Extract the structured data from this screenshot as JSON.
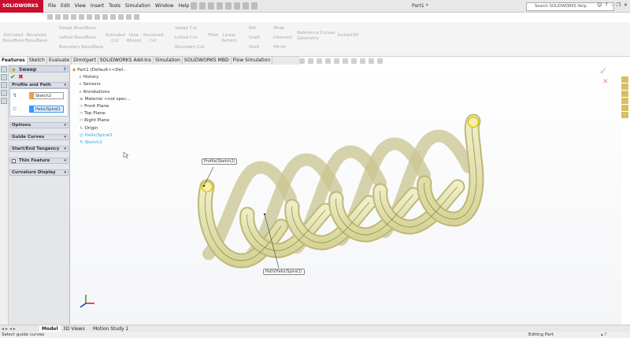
{
  "app": {
    "logo": "SOLIDWORKS",
    "doc_title": "Part1 *",
    "help_search_placeholder": "Search SOLIDWORKS Help"
  },
  "menu": [
    "File",
    "Edit",
    "View",
    "Insert",
    "Tools",
    "Simulation",
    "Window",
    "Help"
  ],
  "ribbon": {
    "extruded_boss": "Extruded Boss/Base",
    "revolved_boss": "Revolved Boss/Base",
    "swept_boss": "Swept Boss/Base",
    "lofted_boss": "Lofted Boss/Base",
    "boundary_boss": "Boundary Boss/Base",
    "extruded_cut": "Extruded Cut",
    "hole_wizard": "Hole Wizard",
    "revolved_cut": "Revolved Cut",
    "swept_cut": "Swept Cut",
    "lofted_cut": "Lofted Cut",
    "boundary_cut": "Boundary Cut",
    "fillet": "Fillet",
    "linear_pattern": "Linear Pattern",
    "rib": "Rib",
    "draft": "Draft",
    "shell": "Shell",
    "wrap": "Wrap",
    "intersect": "Intersect",
    "mirror": "Mirror",
    "reference_geometry": "Reference Geometry",
    "curves": "Curves",
    "instant3d": "Instant3D"
  },
  "tabs": [
    "Features",
    "Sketch",
    "Evaluate",
    "DimXpert",
    "SOLIDWORKS Add-Ins",
    "Simulation",
    "SOLIDWORKS MBD",
    "Flow Simulation"
  ],
  "property_manager": {
    "title": "Sweep",
    "profile_path_header": "Profile and Path",
    "profile_value": "Sketch2",
    "path_value": "Helix/Spiral1",
    "sections": [
      "Options",
      "Guide Curves",
      "Start/End Tangency",
      "Thin Feature",
      "Curvature Display"
    ]
  },
  "tree": {
    "root": "Part1  (Default<<Def...",
    "items": [
      "History",
      "Sensors",
      "Annotations",
      "Material <not spec...",
      "Front Plane",
      "Top Plane",
      "Right Plane",
      "Origin",
      "Helix/Spiral1",
      "Sketch2"
    ]
  },
  "callouts": {
    "profile": "Profile(Sketch2)",
    "path": "Path(Helix/Spiral1)"
  },
  "bottom_tabs": [
    "Model",
    "3D Views",
    "Motion Study 1"
  ],
  "status": {
    "left": "Select guide curves",
    "right": "Editing Part"
  },
  "colors": {
    "accent_red": "#c8102e",
    "spring_fill": "#e6e2ae",
    "spring_edge": "#b8b070",
    "helix_path": "#7a8a3a",
    "tree_highlight": "#20b0d8"
  }
}
